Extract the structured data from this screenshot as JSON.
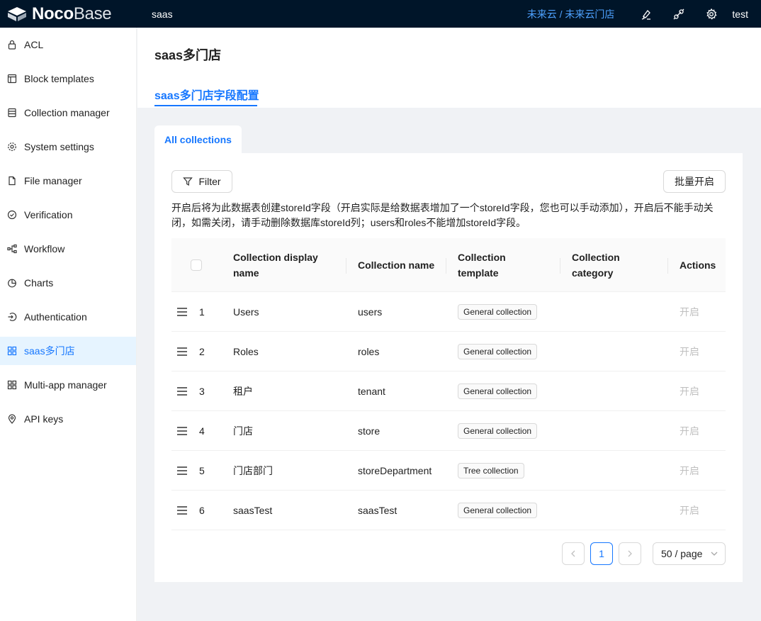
{
  "header": {
    "logo_bold": "Noco",
    "logo_light": "Base",
    "app_title": "saas",
    "breadcrumb_link": "未来云 / 未来云门店",
    "user_name": "test",
    "icons": [
      "highlighter-icon",
      "plugin-icon",
      "gear-icon"
    ]
  },
  "sidebar": {
    "items": [
      {
        "label": "ACL",
        "icon": "lock-icon"
      },
      {
        "label": "Block templates",
        "icon": "layout-icon"
      },
      {
        "label": "Collection manager",
        "icon": "database-icon"
      },
      {
        "label": "System settings",
        "icon": "gear-icon"
      },
      {
        "label": "File manager",
        "icon": "file-icon"
      },
      {
        "label": "Verification",
        "icon": "check-circle-icon"
      },
      {
        "label": "Workflow",
        "icon": "workflow-icon"
      },
      {
        "label": "Charts",
        "icon": "pie-chart-icon"
      },
      {
        "label": "Authentication",
        "icon": "login-icon"
      },
      {
        "label": "saas多门店",
        "icon": "appstore-icon",
        "active": true
      },
      {
        "label": "Multi-app manager",
        "icon": "appstore-icon"
      },
      {
        "label": "API keys",
        "icon": "location-icon"
      }
    ]
  },
  "page": {
    "title": "saas多门店",
    "tab": "saas多门店字段配置"
  },
  "content": {
    "tab": "All collections",
    "filter_label": "Filter",
    "batch_label": "批量开启",
    "note": "开启后将为此数据表创建storeId字段（开启实际是给数据表增加了一个storeId字段，您也可以手动添加），开启后不能手动关闭，如需关闭，请手动删除数据库storeId列；users和roles不能增加storeId字段。"
  },
  "table": {
    "columns": [
      "Collection display name",
      "Collection name",
      "Collection template",
      "Collection category",
      "Actions"
    ],
    "rows": [
      {
        "index": "1",
        "display": "Users",
        "name": "users",
        "template": "General collection",
        "action": "开启"
      },
      {
        "index": "2",
        "display": "Roles",
        "name": "roles",
        "template": "General collection",
        "action": "开启"
      },
      {
        "index": "3",
        "display": "租户",
        "name": "tenant",
        "template": "General collection",
        "action": "开启"
      },
      {
        "index": "4",
        "display": "门店",
        "name": "store",
        "template": "General collection",
        "action": "开启"
      },
      {
        "index": "5",
        "display": "门店部门",
        "name": "storeDepartment",
        "template": "Tree collection",
        "action": "开启"
      },
      {
        "index": "6",
        "display": "saasTest",
        "name": "saasTest",
        "template": "General collection",
        "action": "开启"
      }
    ]
  },
  "pagination": {
    "current": "1",
    "page_size": "50 / page"
  },
  "colors": {
    "header_bg": "#001529",
    "primary": "#1677ff",
    "link": "#4ea2ff",
    "active_bg": "#e6f4ff"
  }
}
